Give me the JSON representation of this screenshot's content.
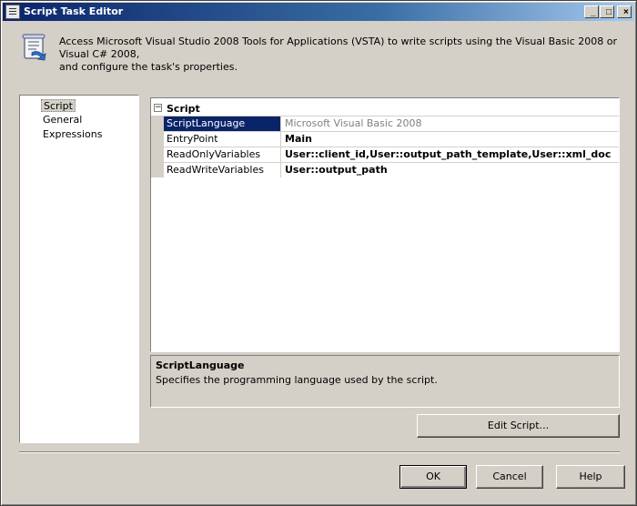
{
  "window": {
    "title": "Script Task Editor",
    "minimize": "_",
    "maximize": "□",
    "close": "×"
  },
  "header": {
    "line1": "Access Microsoft Visual Studio 2008 Tools for Applications (VSTA) to write scripts using the Visual Basic 2008 or Visual C# 2008,",
    "line2": "and configure the task's properties."
  },
  "nav": {
    "items": [
      {
        "label": "Script",
        "selected": true
      },
      {
        "label": "General",
        "selected": false
      },
      {
        "label": "Expressions",
        "selected": false
      }
    ]
  },
  "grid": {
    "category": "Script",
    "toggle": "−",
    "rows": [
      {
        "name": "ScriptLanguage",
        "value": "Microsoft Visual Basic 2008"
      },
      {
        "name": "EntryPoint",
        "value": "Main"
      },
      {
        "name": "ReadOnlyVariables",
        "value": "User::client_id,User::output_path_template,User::xml_doc"
      },
      {
        "name": "ReadWriteVariables",
        "value": "User::output_path"
      }
    ]
  },
  "description": {
    "title": "ScriptLanguage",
    "body": "Specifies the programming language used by the script."
  },
  "buttons": {
    "edit_script": "Edit Script...",
    "ok": "OK",
    "cancel": "Cancel",
    "help": "Help"
  },
  "colors": {
    "selection": "#0a246a",
    "face": "#d4d0c8"
  },
  "icons": {
    "title": "script-task-icon",
    "header": "script-scroll-icon"
  }
}
